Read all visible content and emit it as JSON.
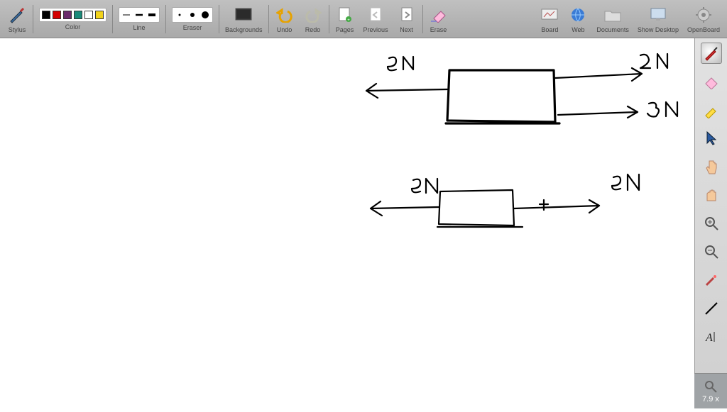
{
  "toolbar": {
    "stylus": "Stylus",
    "color": "Color",
    "line": "Line",
    "eraser": "Eraser",
    "backgrounds": "Backgrounds",
    "undo": "Undo",
    "redo": "Redo",
    "pages": "Pages",
    "previous": "Previous",
    "next": "Next",
    "erase": "Erase",
    "board": "Board",
    "web": "Web",
    "documents": "Documents",
    "show_desktop": "Show Desktop",
    "openboard": "OpenBoard",
    "swatches": [
      "#000000",
      "#d40000",
      "#6b2a6b",
      "#1a8a7a",
      "#ffffff",
      "#f2d31b"
    ]
  },
  "right_tools": {
    "pen": "pen-tool",
    "eraser": "eraser-tool",
    "marker": "marker-tool",
    "pointer": "pointer-tool",
    "hand": "interact-tool",
    "grab": "scroll-tool",
    "zoom_in": "zoom-in",
    "zoom_out": "zoom-out",
    "laser": "laser-tool",
    "line": "line-tool",
    "text": "text-tool"
  },
  "zoom": {
    "label": "7.9 x"
  },
  "drawing": {
    "diagram1": {
      "leftForce": "5N",
      "rightForceTop": "2N",
      "rightForceBottom": "3N"
    },
    "diagram2": {
      "leftForce": "5N",
      "rightForce": "5N",
      "plus": "+"
    }
  }
}
